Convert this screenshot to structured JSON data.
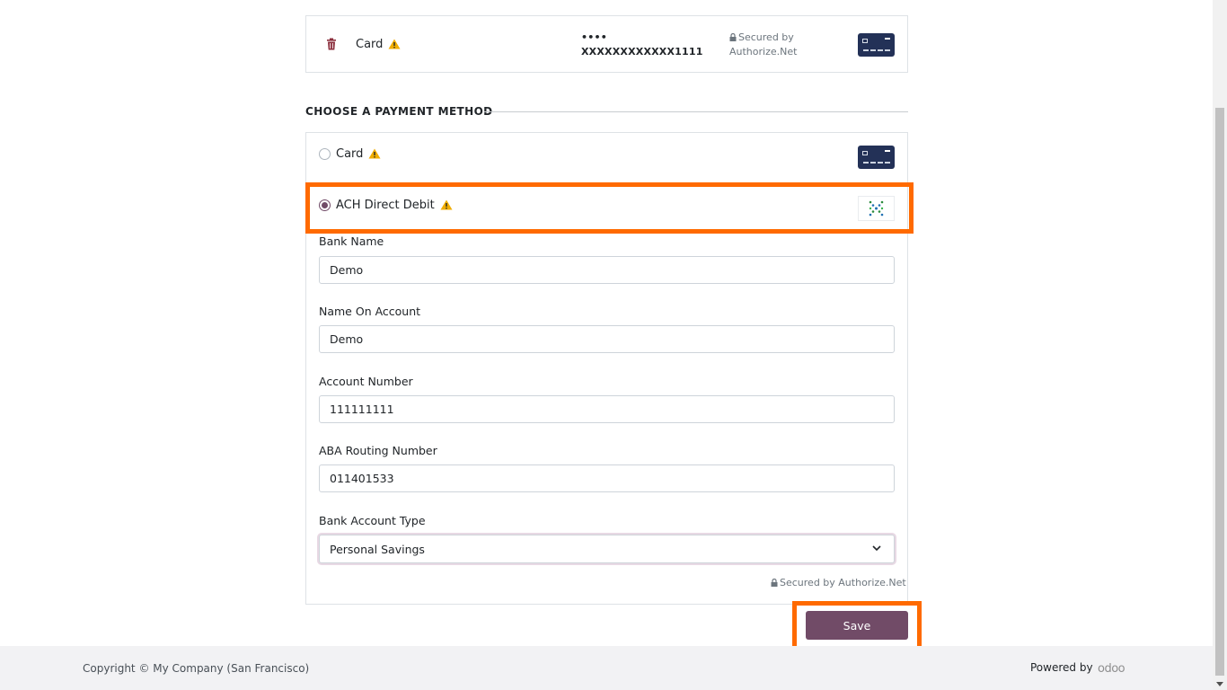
{
  "saved_token": {
    "label": "Card",
    "masked_dots": "••••",
    "masked_number": "XXXXXXXXXXXX1111",
    "secured_line1": "Secured by",
    "secured_line2": "Authorize.Net"
  },
  "section_title": "CHOOSE A PAYMENT METHOD",
  "methods": [
    {
      "label": "Card",
      "selected": false
    },
    {
      "label": "ACH Direct Debit",
      "selected": true
    }
  ],
  "fields": {
    "bank_name": {
      "label": "Bank Name",
      "value": "Demo"
    },
    "name_on_account": {
      "label": "Name On Account",
      "value": "Demo"
    },
    "account_number": {
      "label": "Account Number",
      "value": "111111111"
    },
    "aba_routing": {
      "label": "ABA Routing Number",
      "value": "011401533"
    },
    "account_type": {
      "label": "Bank Account Type",
      "value": "Personal Savings"
    }
  },
  "secured_by": "Secured by Authorize.Net",
  "save_label": "Save",
  "footer": {
    "copyright": "Copyright © My Company (San Francisco)",
    "powered_by": "Powered by",
    "brand": "odoo"
  },
  "colors": {
    "brand": "#714b67",
    "highlight": "#ff6a00",
    "warning": "#f0ad00"
  }
}
